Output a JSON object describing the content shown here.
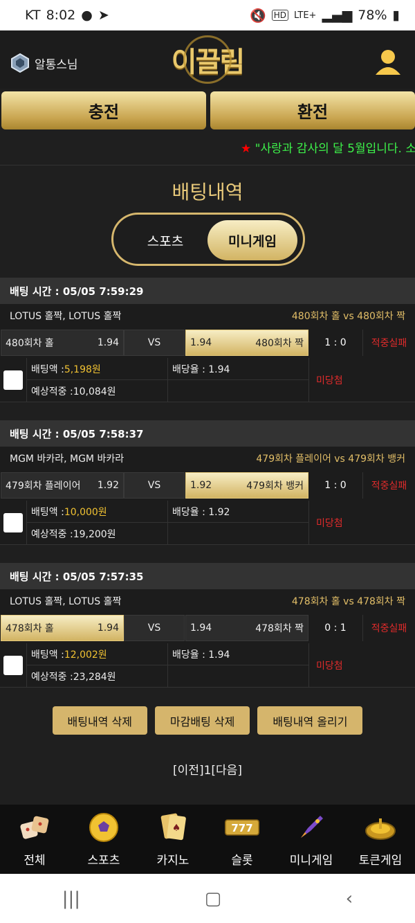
{
  "status": {
    "carrier": "KT",
    "time": "8:02",
    "network": "LTE+",
    "battery": "78%"
  },
  "header": {
    "username": "알통스님",
    "logo": "이끌림"
  },
  "actions_top": {
    "deposit": "충전",
    "withdraw": "환전"
  },
  "ticker": {
    "star": "★",
    "text": "\"사랑과 감사의 달 5월입니다. 소"
  },
  "page": {
    "title": "배팅내역",
    "tab_sports": "스포츠",
    "tab_mini": "미니게임"
  },
  "bets": [
    {
      "time": "배팅 시간 : 05/05 7:59:29",
      "game": "LOTUS 홀짝, LOTUS 홀짝",
      "matchup": "480회차 홀  vs  480회차 짝",
      "home_name": "480회차 홀",
      "home_odds": "1.94",
      "vs": "VS",
      "away_odds": "1.94",
      "away_name": "480회차 짝",
      "score": "1 : 0",
      "result": "적중실패",
      "amount_label": "배팅액 : ",
      "amount": "5,198원",
      "rate": "배당율 : 1.94",
      "expected_label": "예상적중 : ",
      "expected": "10,084원",
      "status": "미당첨"
    },
    {
      "time": "배팅 시간 : 05/05 7:58:37",
      "game": "MGM 바카라, MGM 바카라",
      "matchup": "479회차 플레이어  vs  479회차 뱅커",
      "home_name": "479회차 플레이어",
      "home_odds": "1.92",
      "vs": "VS",
      "away_odds": "1.92",
      "away_name": "479회차 뱅커",
      "score": "1 : 0",
      "result": "적중실패",
      "amount_label": "배팅액 : ",
      "amount": "10,000원",
      "rate": "배당율 : 1.92",
      "expected_label": "예상적중 : ",
      "expected": "19,200원",
      "status": "미당첨"
    },
    {
      "time": "배팅 시간 : 05/05 7:57:35",
      "game": "LOTUS 홀짝, LOTUS 홀짝",
      "matchup": "478회차 홀  vs  478회차 짝",
      "home_name": "478회차 홀",
      "home_odds": "1.94",
      "vs": "VS",
      "away_odds": "1.94",
      "away_name": "478회차 짝",
      "score": "0 : 1",
      "result": "적중실패",
      "amount_label": "배팅액 : ",
      "amount": "12,002원",
      "rate": "배당율 : 1.94",
      "expected_label": "예상적중 : ",
      "expected": "23,284원",
      "status": "미당첨"
    }
  ],
  "bottom_actions": {
    "delete_history": "배팅내역 삭제",
    "delete_closed": "마감배팅 삭제",
    "post_history": "배팅내역 올리기"
  },
  "pager": "[이전]1[다음]",
  "nav": {
    "all": "전체",
    "sports": "스포츠",
    "casino": "카지노",
    "slot": "슬롯",
    "mini": "미니게임",
    "token": "토큰게임"
  }
}
